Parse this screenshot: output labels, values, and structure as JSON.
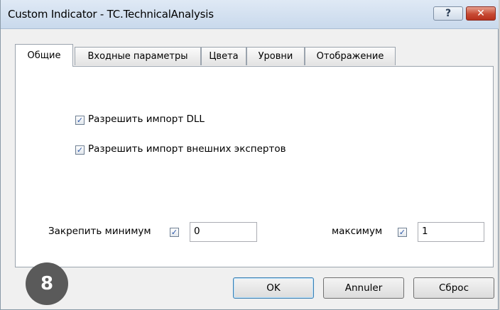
{
  "window": {
    "title": "Custom Indicator - TC.TechnicalAnalysis",
    "help_glyph": "?",
    "close_glyph": "✕"
  },
  "tabs": [
    {
      "label": "Общие",
      "active": true
    },
    {
      "label": "Входные параметры",
      "active": false
    },
    {
      "label": "Цвета",
      "active": false
    },
    {
      "label": "Уровни",
      "active": false
    },
    {
      "label": "Отображение",
      "active": false
    }
  ],
  "options": {
    "allow_dll": {
      "label": "Разрешить импорт DLL",
      "checked": true
    },
    "allow_experts": {
      "label": "Разрешить импорт внешних экспертов",
      "checked": true
    }
  },
  "fix_min": {
    "label": "Закрепить минимум",
    "checked": true,
    "value": "0"
  },
  "fix_max": {
    "label": "максимум",
    "checked": true,
    "value": "1"
  },
  "buttons": {
    "ok": "OK",
    "cancel": "Annuler",
    "reset": "Сброс"
  },
  "badge": "8",
  "check_glyph": "✓"
}
